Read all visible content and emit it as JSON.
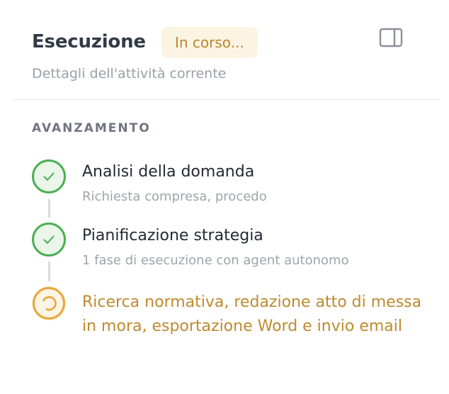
{
  "header": {
    "title": "Esecuzione",
    "status_badge": "In corso...",
    "subtitle": "Dettagli dell'attività corrente",
    "toggle_icon": "sidebar-panel-icon"
  },
  "progress": {
    "section_label": "AVANZAMENTO",
    "steps": [
      {
        "title": "Analisi della domanda",
        "description": "Richiesta compresa, procedo",
        "status": "completed",
        "icon": "check-icon"
      },
      {
        "title": "Pianificazione strategia",
        "description": "1 fase di esecuzione con agent autonomo",
        "status": "completed",
        "icon": "check-icon"
      },
      {
        "title": "Ricerca normativa, redazione atto di messa in mora, esportazione Word e invio email",
        "status": "in-progress",
        "icon": "spinner-icon"
      }
    ]
  },
  "colors": {
    "completed": "#4caf50",
    "completed_bg": "#eaf6ea",
    "in_progress": "#e6a83b",
    "in_progress_bg": "#fdf4e4",
    "badge_bg": "#fcf4e3",
    "badge_text": "#b9852d"
  }
}
